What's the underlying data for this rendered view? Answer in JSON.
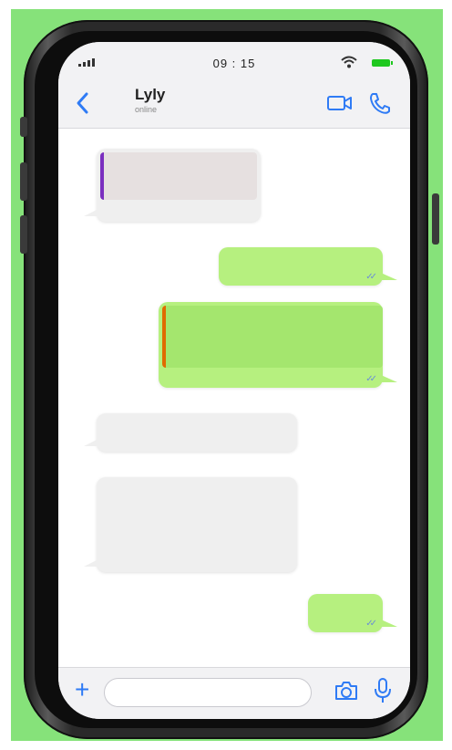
{
  "status_bar": {
    "time": "09 : 15"
  },
  "header": {
    "contact_name": "Lyly",
    "contact_status": "online"
  },
  "icons": {
    "back": "chevron-left-icon",
    "video": "video-camera-icon",
    "call": "phone-icon",
    "plus": "plus-icon",
    "camera": "camera-icon",
    "mic": "microphone-icon",
    "read_receipt": "double-check-icon"
  },
  "input": {
    "plus_symbol": "+",
    "read_mark": "✓✓"
  },
  "colors": {
    "background": "#86e27a",
    "accent": "#2f7bf5",
    "outgoing_bubble": "#b6f07f",
    "incoming_bubble": "#efefef",
    "quote_bar_incoming": "#7b2fbf",
    "quote_bar_outgoing": "#e06a00"
  }
}
